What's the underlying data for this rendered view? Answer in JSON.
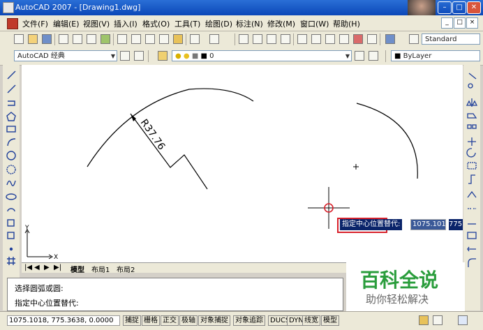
{
  "window": {
    "title": "AutoCAD 2007 - [Drawing1.dwg]",
    "min_label": "–",
    "max_label": "□",
    "close_label": "✕"
  },
  "menu": {
    "items": [
      "文件(F)",
      "编辑(E)",
      "视图(V)",
      "插入(I)",
      "格式(O)",
      "工具(T)",
      "绘图(D)",
      "标注(N)",
      "修改(M)",
      "窗口(W)",
      "帮助(H)"
    ],
    "mdi": [
      "_",
      "□",
      "×"
    ]
  },
  "toolbar2": {
    "workspace": "AutoCAD 经典",
    "layer": "0",
    "textstyle": "Standard",
    "linetype": "ByLayer"
  },
  "drawing": {
    "dimension_text": "R37.76",
    "tooltip": "指定中心位置替代:",
    "coord_x": "1075.1018",
    "coord_y": "775.3638",
    "ucs_y": "Y",
    "ucs_x": "X"
  },
  "tabs": {
    "items": [
      "模型",
      "布局1",
      "布局2"
    ],
    "nav": [
      "|◀",
      "◀",
      "▶",
      "▶|"
    ]
  },
  "command": {
    "line1": "选择圆弧或圆:",
    "line2": "指定中心位置替代:"
  },
  "watermark": {
    "title": "百科全说",
    "subtitle": "助你轻松解决"
  },
  "status": {
    "coords": "1075.1018,  775.3638,  0.0000",
    "buttons": [
      "捕捉",
      "栅格",
      "正交",
      "极轴",
      "对象捕捉",
      "对象追踪",
      "DUCS",
      "DYN",
      "线宽",
      "模型"
    ]
  },
  "colors": {
    "title_blue": "#0b47b8",
    "highlight_red": "#d8202a",
    "tooltip_bg": "#0a246a",
    "watermark_green": "#2a9d3c"
  }
}
